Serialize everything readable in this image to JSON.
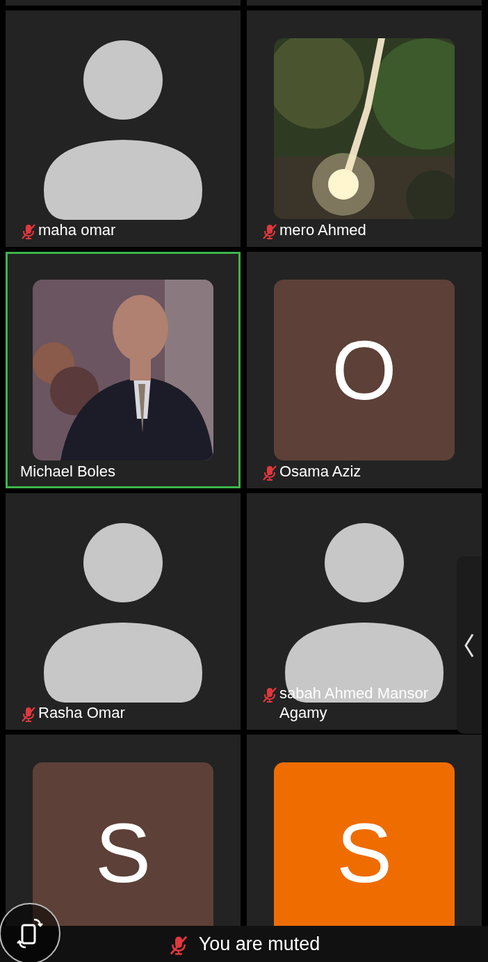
{
  "participants": [
    {
      "name": "maha omar",
      "kind": "silhouette",
      "muted": true,
      "selected": false
    },
    {
      "name": "mero Ahmed",
      "muted": true,
      "selected": false
    },
    {
      "name": "Michael Boles",
      "muted": false,
      "selected": true
    },
    {
      "name": "Osama Aziz",
      "kind": "initial",
      "initial": "O",
      "color": "#5d4037",
      "muted": true,
      "selected": false
    },
    {
      "name": "Rasha Omar",
      "kind": "silhouette",
      "muted": true,
      "selected": false
    },
    {
      "name": "sabah Ahmed Mansor Agamy",
      "kind": "silhouette",
      "muted": true,
      "selected": false
    },
    {
      "kind": "initial",
      "initial": "S",
      "color": "#5d4037",
      "selected": false
    },
    {
      "kind": "initial",
      "initial": "S",
      "color": "#ef6c00",
      "selected": false
    }
  ],
  "status": {
    "text": "You are muted",
    "muted": true
  }
}
